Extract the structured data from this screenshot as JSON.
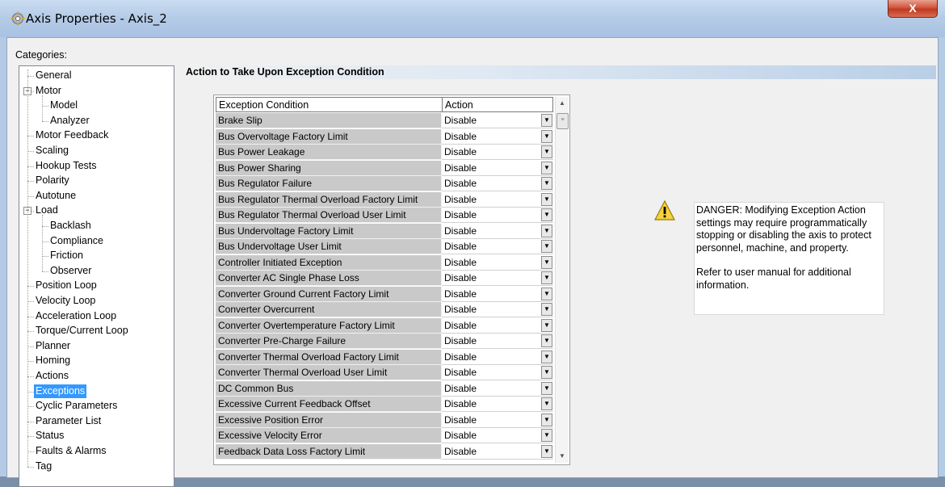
{
  "window": {
    "title": "Axis Properties - Axis_2",
    "close_label": "X"
  },
  "categories": {
    "label": "Categories:",
    "items": [
      {
        "label": "General",
        "level": 0,
        "expander": ""
      },
      {
        "label": "Motor",
        "level": 0,
        "expander": "-"
      },
      {
        "label": "Model",
        "level": 1,
        "expander": ""
      },
      {
        "label": "Analyzer",
        "level": 1,
        "expander": ""
      },
      {
        "label": "Motor Feedback",
        "level": 0,
        "expander": ""
      },
      {
        "label": "Scaling",
        "level": 0,
        "expander": ""
      },
      {
        "label": "Hookup Tests",
        "level": 0,
        "expander": ""
      },
      {
        "label": "Polarity",
        "level": 0,
        "expander": ""
      },
      {
        "label": "Autotune",
        "level": 0,
        "expander": ""
      },
      {
        "label": "Load",
        "level": 0,
        "expander": "-"
      },
      {
        "label": "Backlash",
        "level": 1,
        "expander": ""
      },
      {
        "label": "Compliance",
        "level": 1,
        "expander": ""
      },
      {
        "label": "Friction",
        "level": 1,
        "expander": ""
      },
      {
        "label": "Observer",
        "level": 1,
        "expander": ""
      },
      {
        "label": "Position Loop",
        "level": 0,
        "expander": ""
      },
      {
        "label": "Velocity Loop",
        "level": 0,
        "expander": ""
      },
      {
        "label": "Acceleration Loop",
        "level": 0,
        "expander": ""
      },
      {
        "label": "Torque/Current Loop",
        "level": 0,
        "expander": ""
      },
      {
        "label": "Planner",
        "level": 0,
        "expander": ""
      },
      {
        "label": "Homing",
        "level": 0,
        "expander": ""
      },
      {
        "label": "Actions",
        "level": 0,
        "expander": ""
      },
      {
        "label": "Exceptions",
        "level": 0,
        "expander": "",
        "selected": true
      },
      {
        "label": "Cyclic Parameters",
        "level": 0,
        "expander": ""
      },
      {
        "label": "Parameter List",
        "level": 0,
        "expander": ""
      },
      {
        "label": "Status",
        "level": 0,
        "expander": ""
      },
      {
        "label": "Faults & Alarms",
        "level": 0,
        "expander": ""
      },
      {
        "label": "Tag",
        "level": 0,
        "expander": ""
      }
    ]
  },
  "section": {
    "title": "Action to Take Upon Exception Condition"
  },
  "table": {
    "headers": [
      "Exception Condition",
      "Action"
    ],
    "rows": [
      {
        "condition": "Brake Slip",
        "action": "Disable"
      },
      {
        "condition": "Bus Overvoltage Factory Limit",
        "action": "Disable"
      },
      {
        "condition": "Bus Power Leakage",
        "action": "Disable"
      },
      {
        "condition": "Bus Power Sharing",
        "action": "Disable"
      },
      {
        "condition": "Bus Regulator Failure",
        "action": "Disable"
      },
      {
        "condition": "Bus Regulator Thermal Overload Factory Limit",
        "action": "Disable"
      },
      {
        "condition": "Bus Regulator Thermal Overload User Limit",
        "action": "Disable"
      },
      {
        "condition": "Bus Undervoltage Factory Limit",
        "action": "Disable"
      },
      {
        "condition": "Bus Undervoltage User Limit",
        "action": "Disable"
      },
      {
        "condition": "Controller Initiated Exception",
        "action": "Disable"
      },
      {
        "condition": "Converter AC Single Phase Loss",
        "action": "Disable"
      },
      {
        "condition": "Converter Ground Current Factory Limit",
        "action": "Disable"
      },
      {
        "condition": "Converter Overcurrent",
        "action": "Disable"
      },
      {
        "condition": "Converter Overtemperature Factory Limit",
        "action": "Disable"
      },
      {
        "condition": "Converter Pre-Charge Failure",
        "action": "Disable"
      },
      {
        "condition": "Converter Thermal Overload Factory Limit",
        "action": "Disable"
      },
      {
        "condition": "Converter Thermal Overload User Limit",
        "action": "Disable"
      },
      {
        "condition": "DC Common Bus",
        "action": "Disable"
      },
      {
        "condition": "Excessive Current Feedback Offset",
        "action": "Disable"
      },
      {
        "condition": "Excessive Position Error",
        "action": "Disable"
      },
      {
        "condition": "Excessive Velocity Error",
        "action": "Disable"
      },
      {
        "condition": "Feedback Data Loss Factory Limit",
        "action": "Disable"
      }
    ]
  },
  "warning": {
    "text1": "DANGER: Modifying Exception Action settings may require programmatically stopping or disabling the axis to protect personnel, machine, and property.",
    "text2": "Refer to user manual for additional information."
  },
  "icons": {
    "window": "gear-icon",
    "warning": "warning-triangle-icon",
    "dropdown": "chevron-down-icon"
  }
}
